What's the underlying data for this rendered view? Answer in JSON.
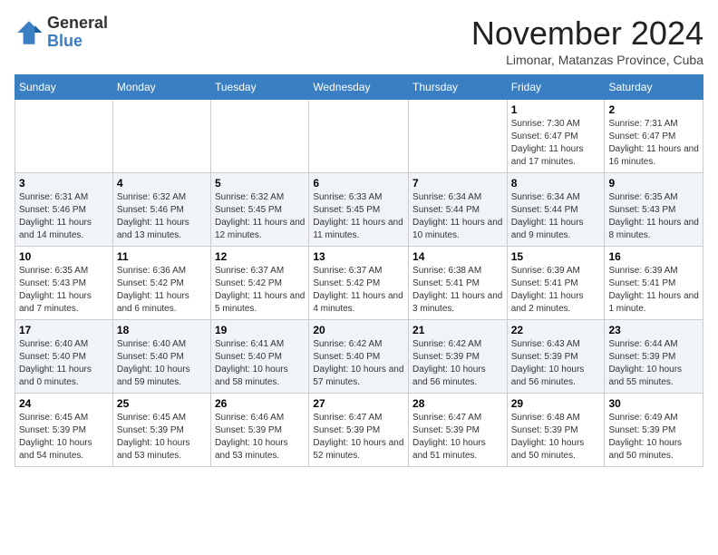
{
  "logo": {
    "general": "General",
    "blue": "Blue"
  },
  "title": "November 2024",
  "location": "Limonar, Matanzas Province, Cuba",
  "days_of_week": [
    "Sunday",
    "Monday",
    "Tuesday",
    "Wednesday",
    "Thursday",
    "Friday",
    "Saturday"
  ],
  "weeks": [
    [
      {
        "day": "",
        "info": ""
      },
      {
        "day": "",
        "info": ""
      },
      {
        "day": "",
        "info": ""
      },
      {
        "day": "",
        "info": ""
      },
      {
        "day": "",
        "info": ""
      },
      {
        "day": "1",
        "info": "Sunrise: 7:30 AM\nSunset: 6:47 PM\nDaylight: 11 hours and 17 minutes."
      },
      {
        "day": "2",
        "info": "Sunrise: 7:31 AM\nSunset: 6:47 PM\nDaylight: 11 hours and 16 minutes."
      }
    ],
    [
      {
        "day": "3",
        "info": "Sunrise: 6:31 AM\nSunset: 5:46 PM\nDaylight: 11 hours and 14 minutes."
      },
      {
        "day": "4",
        "info": "Sunrise: 6:32 AM\nSunset: 5:46 PM\nDaylight: 11 hours and 13 minutes."
      },
      {
        "day": "5",
        "info": "Sunrise: 6:32 AM\nSunset: 5:45 PM\nDaylight: 11 hours and 12 minutes."
      },
      {
        "day": "6",
        "info": "Sunrise: 6:33 AM\nSunset: 5:45 PM\nDaylight: 11 hours and 11 minutes."
      },
      {
        "day": "7",
        "info": "Sunrise: 6:34 AM\nSunset: 5:44 PM\nDaylight: 11 hours and 10 minutes."
      },
      {
        "day": "8",
        "info": "Sunrise: 6:34 AM\nSunset: 5:44 PM\nDaylight: 11 hours and 9 minutes."
      },
      {
        "day": "9",
        "info": "Sunrise: 6:35 AM\nSunset: 5:43 PM\nDaylight: 11 hours and 8 minutes."
      }
    ],
    [
      {
        "day": "10",
        "info": "Sunrise: 6:35 AM\nSunset: 5:43 PM\nDaylight: 11 hours and 7 minutes."
      },
      {
        "day": "11",
        "info": "Sunrise: 6:36 AM\nSunset: 5:42 PM\nDaylight: 11 hours and 6 minutes."
      },
      {
        "day": "12",
        "info": "Sunrise: 6:37 AM\nSunset: 5:42 PM\nDaylight: 11 hours and 5 minutes."
      },
      {
        "day": "13",
        "info": "Sunrise: 6:37 AM\nSunset: 5:42 PM\nDaylight: 11 hours and 4 minutes."
      },
      {
        "day": "14",
        "info": "Sunrise: 6:38 AM\nSunset: 5:41 PM\nDaylight: 11 hours and 3 minutes."
      },
      {
        "day": "15",
        "info": "Sunrise: 6:39 AM\nSunset: 5:41 PM\nDaylight: 11 hours and 2 minutes."
      },
      {
        "day": "16",
        "info": "Sunrise: 6:39 AM\nSunset: 5:41 PM\nDaylight: 11 hours and 1 minute."
      }
    ],
    [
      {
        "day": "17",
        "info": "Sunrise: 6:40 AM\nSunset: 5:40 PM\nDaylight: 11 hours and 0 minutes."
      },
      {
        "day": "18",
        "info": "Sunrise: 6:40 AM\nSunset: 5:40 PM\nDaylight: 10 hours and 59 minutes."
      },
      {
        "day": "19",
        "info": "Sunrise: 6:41 AM\nSunset: 5:40 PM\nDaylight: 10 hours and 58 minutes."
      },
      {
        "day": "20",
        "info": "Sunrise: 6:42 AM\nSunset: 5:40 PM\nDaylight: 10 hours and 57 minutes."
      },
      {
        "day": "21",
        "info": "Sunrise: 6:42 AM\nSunset: 5:39 PM\nDaylight: 10 hours and 56 minutes."
      },
      {
        "day": "22",
        "info": "Sunrise: 6:43 AM\nSunset: 5:39 PM\nDaylight: 10 hours and 56 minutes."
      },
      {
        "day": "23",
        "info": "Sunrise: 6:44 AM\nSunset: 5:39 PM\nDaylight: 10 hours and 55 minutes."
      }
    ],
    [
      {
        "day": "24",
        "info": "Sunrise: 6:45 AM\nSunset: 5:39 PM\nDaylight: 10 hours and 54 minutes."
      },
      {
        "day": "25",
        "info": "Sunrise: 6:45 AM\nSunset: 5:39 PM\nDaylight: 10 hours and 53 minutes."
      },
      {
        "day": "26",
        "info": "Sunrise: 6:46 AM\nSunset: 5:39 PM\nDaylight: 10 hours and 53 minutes."
      },
      {
        "day": "27",
        "info": "Sunrise: 6:47 AM\nSunset: 5:39 PM\nDaylight: 10 hours and 52 minutes."
      },
      {
        "day": "28",
        "info": "Sunrise: 6:47 AM\nSunset: 5:39 PM\nDaylight: 10 hours and 51 minutes."
      },
      {
        "day": "29",
        "info": "Sunrise: 6:48 AM\nSunset: 5:39 PM\nDaylight: 10 hours and 50 minutes."
      },
      {
        "day": "30",
        "info": "Sunrise: 6:49 AM\nSunset: 5:39 PM\nDaylight: 10 hours and 50 minutes."
      }
    ]
  ]
}
